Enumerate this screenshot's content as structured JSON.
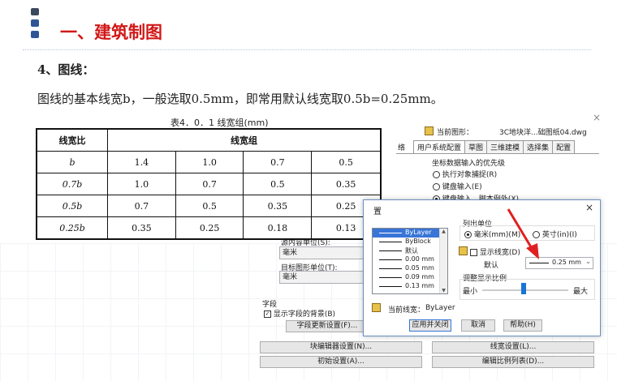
{
  "slide": {
    "title": "一、建筑制图",
    "heading": "4、图线：",
    "body": "图线的基本线宽b，一般选取0.5mm，即常用默认线宽取0.5b=0.25mm。"
  },
  "table": {
    "caption": "表4．0．1 线宽组(mm)",
    "header": [
      "线宽比",
      "线宽组"
    ],
    "rows": [
      [
        "b",
        "1.4",
        "1.0",
        "0.7",
        "0.5"
      ],
      [
        "0.7b",
        "1.0",
        "0.7",
        "0.5",
        "0.35"
      ],
      [
        "0.5b",
        "0.7",
        "0.5",
        "0.35",
        "0.25"
      ],
      [
        "0.25b",
        "0.35",
        "0.25",
        "0.18",
        "0.13"
      ]
    ]
  },
  "options_window": {
    "close_label": "×",
    "current_drawing_label": "当前图形：",
    "current_drawing_value": "3C地块洋...础图纸04.dwg",
    "partial_tab": "络",
    "tabs": [
      "用户系统配置",
      "草图",
      "三维建模",
      "选择集",
      "配置"
    ],
    "coord_group_label": "坐标数据输入的优先级",
    "coord_options": [
      "执行对象捕捉(R)",
      "键盘输入(E)",
      "键盘输入，脚本例外(X)"
    ],
    "source_units_label": "源内容单位(S):",
    "source_units_value": "毫米",
    "target_units_label": "目标图形单位(T):",
    "target_units_value": "毫米",
    "fields_label": "字段",
    "show_field_bg_label": "显示字段的背景(B)",
    "field_update_button": "字段更新设置(F)...",
    "block_editor_button": "块编辑器设置(N)...",
    "lineweight_settings_button": "线宽设置(L)...",
    "initial_setup_button": "初始设置(A)...",
    "scale_list_button": "编辑比例列表(D)..."
  },
  "lineweight_dialog": {
    "title": "置",
    "close_label": "×",
    "list_items": [
      "ByLayer",
      "ByBlock",
      "默认",
      "0.00 mm",
      "0.05 mm",
      "0.09 mm",
      "0.13 mm"
    ],
    "units_label": "列出单位",
    "unit_mm": "毫米(mm)(M)",
    "unit_in": "英寸(in)(I)",
    "display_lw_label": "显示线宽(D)",
    "default_label": "默认",
    "default_value": "0.25 mm",
    "scale_label": "调整显示比例",
    "scale_min": "最小",
    "scale_max": "最大",
    "slider_level": 0.48,
    "current_lw_label": "当前线宽：",
    "current_lw_value": "ByLayer",
    "apply_close_button": "应用并关闭",
    "cancel_button": "取消",
    "help_button": "帮助(H)"
  },
  "colors": {
    "title_red": "#d11818",
    "bullet_blue": "#2f5597",
    "arrow_red": "#e02020",
    "dialog_border": "#6a8ebf"
  }
}
